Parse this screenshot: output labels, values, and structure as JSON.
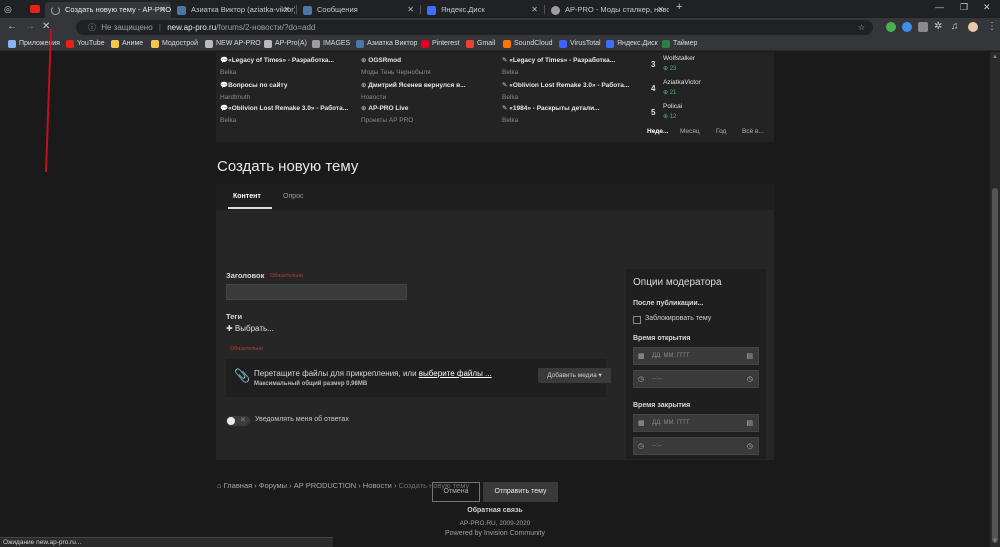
{
  "browser": {
    "tabs": [
      {
        "title": "Создать новую тему - AP-PRO.R",
        "active": true
      },
      {
        "title": "Азиатка Виктор (aziatka-viktor)",
        "active": false
      },
      {
        "title": "Сообщения",
        "active": false
      },
      {
        "title": "Яндекс.Диск",
        "active": false
      },
      {
        "title": "AP-PRO - Моды сталкер, новос",
        "active": false
      }
    ],
    "new_tab": "+",
    "win_minimize": "—",
    "win_restore": "❐",
    "win_close": "✕",
    "address": {
      "security": "Не защищено",
      "host": "new.ap-pro.ru",
      "path": "/forums/2-новости/?do=add"
    },
    "bookmarks": [
      {
        "label": "Приложения",
        "color": "#8ab4f8"
      },
      {
        "label": "YouTube",
        "color": "#e62117"
      },
      {
        "label": "Аниме",
        "color": "#f2c94c"
      },
      {
        "label": "Модострой",
        "color": "#f2c94c"
      },
      {
        "label": "NEW AP-PRO",
        "color": "#bbbbbb"
      },
      {
        "label": "AP-Pro(A)",
        "color": "#bbbbbb"
      },
      {
        "label": "IMAGES",
        "color": "#9e9e9e"
      },
      {
        "label": "Азиатка Виктор",
        "color": "#4a76a8"
      },
      {
        "label": "Pinterest",
        "color": "#e60023"
      },
      {
        "label": "Gmail",
        "color": "#ea4335"
      },
      {
        "label": "SoundCloud",
        "color": "#ff7700"
      },
      {
        "label": "VirusTotal",
        "color": "#3b61ff"
      },
      {
        "label": "Яндекс.Диск",
        "color": "#3b6fff"
      },
      {
        "label": "Таймер",
        "color": "#2d7d46"
      }
    ]
  },
  "activity": {
    "col1": [
      {
        "title": "«Legacy of Times» - Разработка...",
        "author": "Belka"
      },
      {
        "title": "Вопросы по сайту",
        "author": "Hardtmuth"
      },
      {
        "title": "«Oblivion Lost Remake 3.0» - Работа...",
        "author": "Belka"
      }
    ],
    "col2": [
      {
        "title": "OGSRmod",
        "author": "Моды Тень Чернобыля"
      },
      {
        "title": "Дмитрий Ясенев вернулся в...",
        "author": "Новости"
      },
      {
        "title": "AP-PRO Live",
        "author": "Проекты AP PRO"
      }
    ],
    "col3": [
      {
        "title": "«Legacy of Times» - Разработка...",
        "author": "Belka"
      },
      {
        "title": "«Oblivion Lost Remake 3.0» - Работа...",
        "author": "Belka"
      },
      {
        "title": "«1984» - Раскрыты детали...",
        "author": "Belka"
      }
    ],
    "leaders": [
      {
        "rank": "3",
        "name": "Wolfstalker",
        "score": "23"
      },
      {
        "rank": "4",
        "name": "AziatkaVictor",
        "score": "21"
      },
      {
        "rank": "5",
        "name": "Policai",
        "score": "12"
      }
    ],
    "filters": [
      "Неде...",
      "Месяц",
      "Год",
      "Всё в..."
    ]
  },
  "page_title": "Создать новую тему",
  "form": {
    "tabs": [
      "Контент",
      "Опрос"
    ],
    "title_label": "Заголовок",
    "required": "Обязательно",
    "tags_label": "Теги",
    "tags_choose": "✚ Выбрать...",
    "attach_text": "Перетащите файлы для прикрепления, или",
    "attach_link": "выберите файлы ...",
    "attach_max": "Максимальный общий размер 0,98MB",
    "add_media": "Добавить медиа ▾",
    "notify_label": "Уведомлять меня об ответах",
    "cancel": "Отмена",
    "submit": "Отправить тему"
  },
  "moderator": {
    "title": "Опции модератора",
    "after_publish": "После публикации...",
    "lock_label": "Заблокировать тему",
    "open_time": "Время открытия",
    "close_time": "Время закрытия",
    "date_placeholder": "ДД. ММ. ГГГГ",
    "time_placeholder": "--:--"
  },
  "breadcrumb": {
    "items": [
      "Главная",
      "Форумы",
      "AP PRODUCTION",
      "Новости"
    ],
    "current": "Создать новую тему",
    "separator": "›"
  },
  "footer": {
    "feedback": "Обратная связь",
    "copyright": "AP-PRO.RU, 2009-2020",
    "powered": "Powered by Invision Community"
  },
  "status": "Ожидание new.ap-pro.ru..."
}
